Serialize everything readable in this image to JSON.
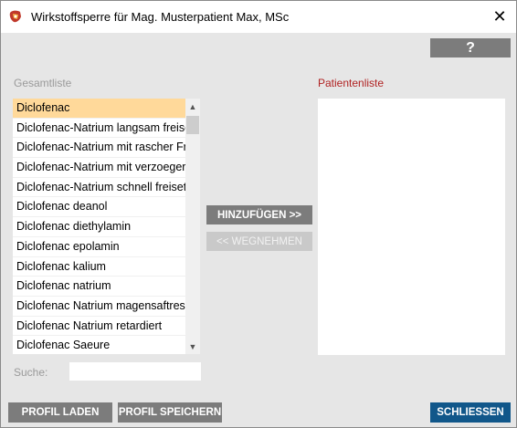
{
  "window": {
    "title": "Wirkstoffsperre für Mag. Musterpatient Max, MSc",
    "close_glyph": "✕",
    "icon": "app-logo-icon"
  },
  "toolbar": {
    "help_label": "?"
  },
  "gesamtliste": {
    "label": "Gesamtliste",
    "items": [
      "Diclofenac",
      "Diclofenac-Natrium langsam freisetzend",
      "Diclofenac-Natrium mit rascher Freisetzung",
      "Diclofenac-Natrium mit verzoegerter Freisetzung",
      "Diclofenac-Natrium schnell freisetzend",
      "Diclofenac deanol",
      "Diclofenac diethylamin",
      "Diclofenac epolamin",
      "Diclofenac kalium",
      "Diclofenac natrium",
      "Diclofenac Natrium magensaftresistent",
      "Diclofenac Natrium retardiert",
      "Diclofenac Saeure"
    ],
    "selected_index": 0
  },
  "patientenliste": {
    "label": "Patientenliste",
    "items": []
  },
  "actions": {
    "add_label": "HINZUFÜGEN >>",
    "remove_label": "<< WEGNEHMEN"
  },
  "search": {
    "label": "Suche:",
    "value": ""
  },
  "footer": {
    "load_label": "PROFIL LADEN",
    "save_label": "PROFIL SPEICHERN",
    "close_label": "SCHLIESSEN"
  },
  "colors": {
    "selected_row": "#ffd99a",
    "primary_button": "#11578a",
    "patient_label": "#b02222"
  }
}
